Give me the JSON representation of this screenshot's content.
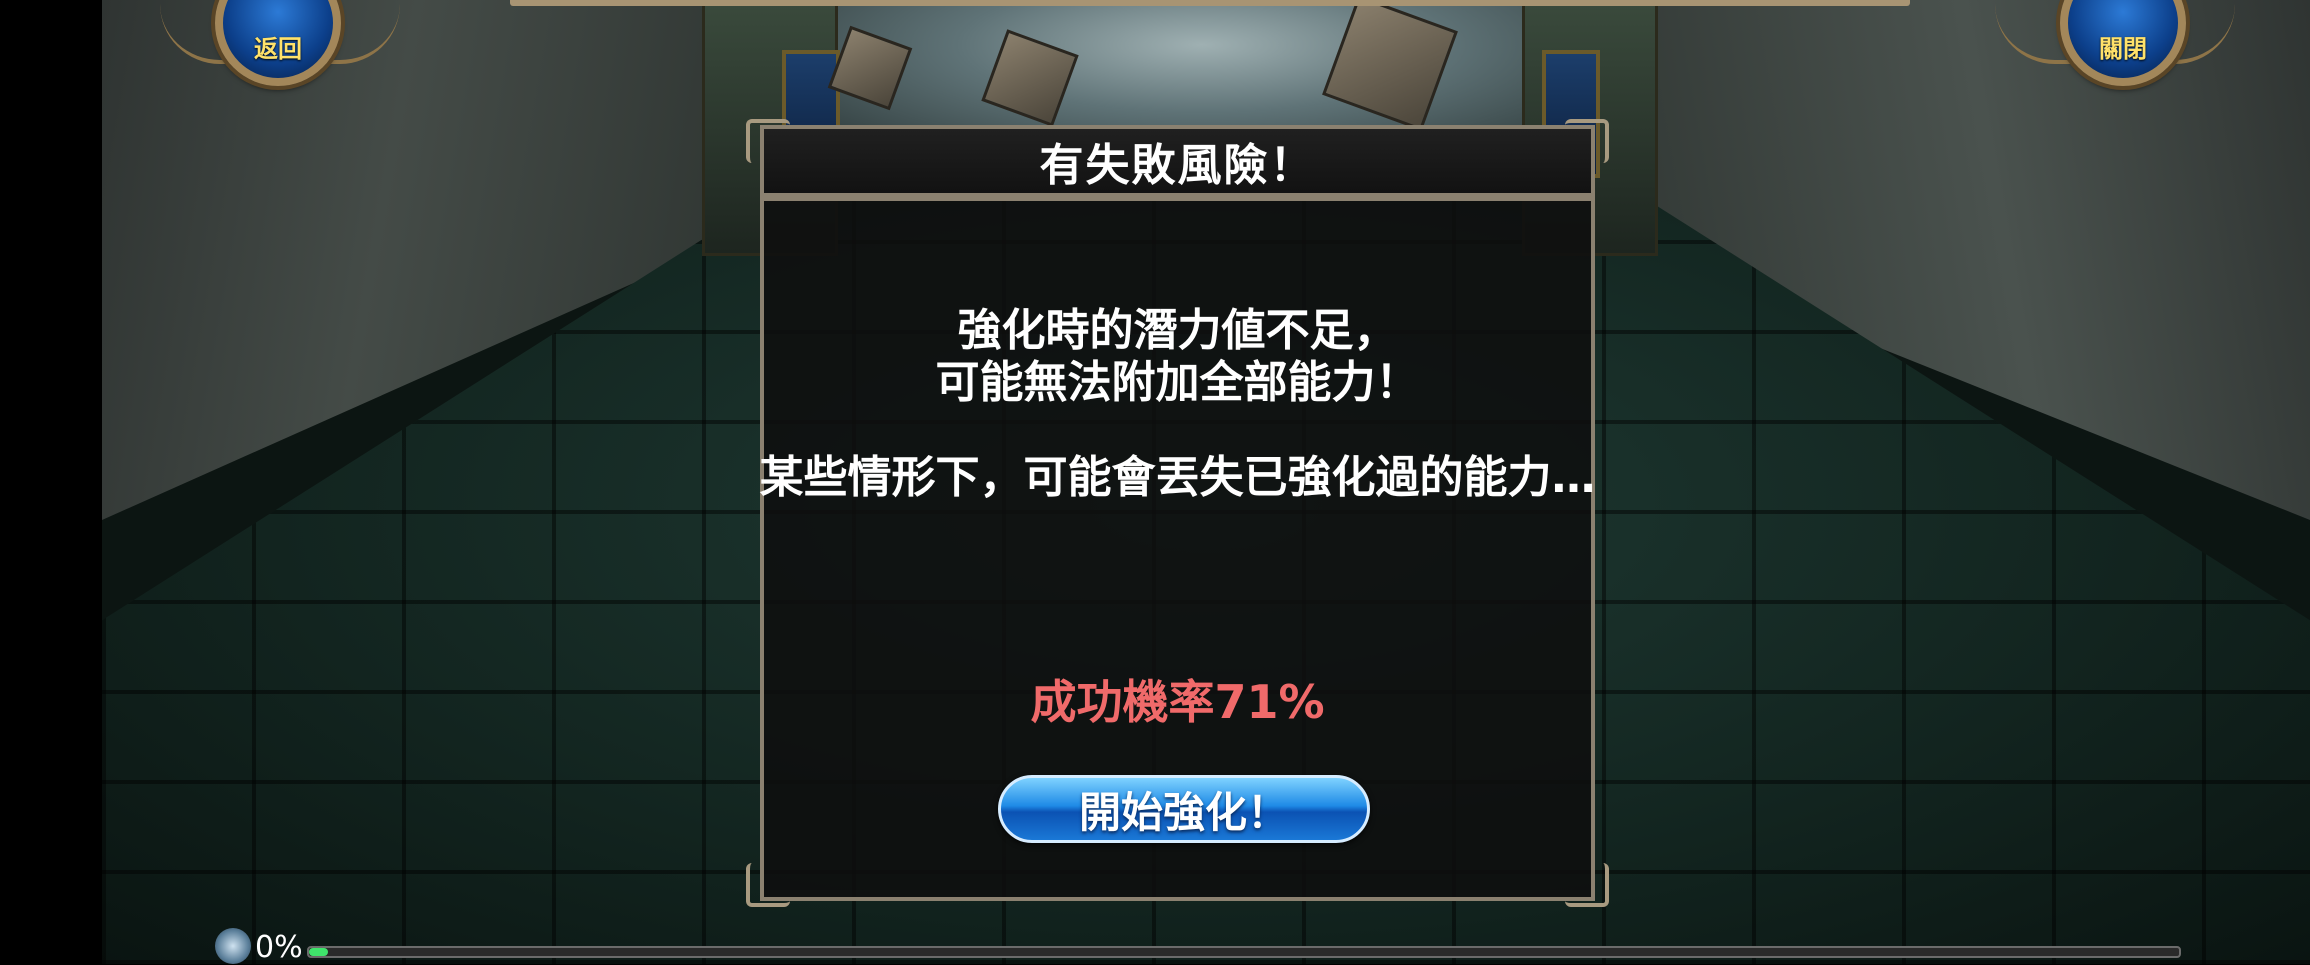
{
  "top_buttons": {
    "back_label": "返回",
    "close_label": "關閉"
  },
  "dialog": {
    "title": "有失敗風險！",
    "message_line1": "強化時的潛力値不足，",
    "message_line2": "可能無法附加全部能力！",
    "message_line3": "某些情形下，可能會丟失已強化過的能力…",
    "success_rate": "成功機率71%",
    "start_button_label": "開始強化！"
  },
  "progress": {
    "text": "0%",
    "value": 0.01
  },
  "colors": {
    "success_rate": "#f06a6a",
    "button_blue": "#1e8ae6",
    "frame": "#8b8170"
  }
}
